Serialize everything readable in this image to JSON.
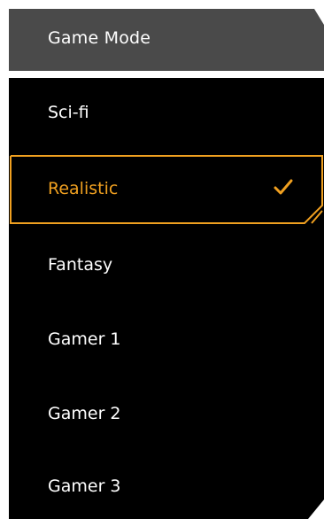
{
  "header": {
    "title": "Game Mode"
  },
  "menu": {
    "items": [
      {
        "label": "Sci-fi",
        "selected": false
      },
      {
        "label": "Realistic",
        "selected": true
      },
      {
        "label": "Fantasy",
        "selected": false
      },
      {
        "label": "Gamer 1",
        "selected": false
      },
      {
        "label": "Gamer 2",
        "selected": false
      },
      {
        "label": "Gamer 3",
        "selected": false
      }
    ]
  },
  "colors": {
    "header_bg": "#4a4a4a",
    "menu_bg": "#000000",
    "accent": "#f0a020",
    "text": "#ffffff"
  },
  "icons": {
    "selected_marker": "checkmark-icon"
  }
}
